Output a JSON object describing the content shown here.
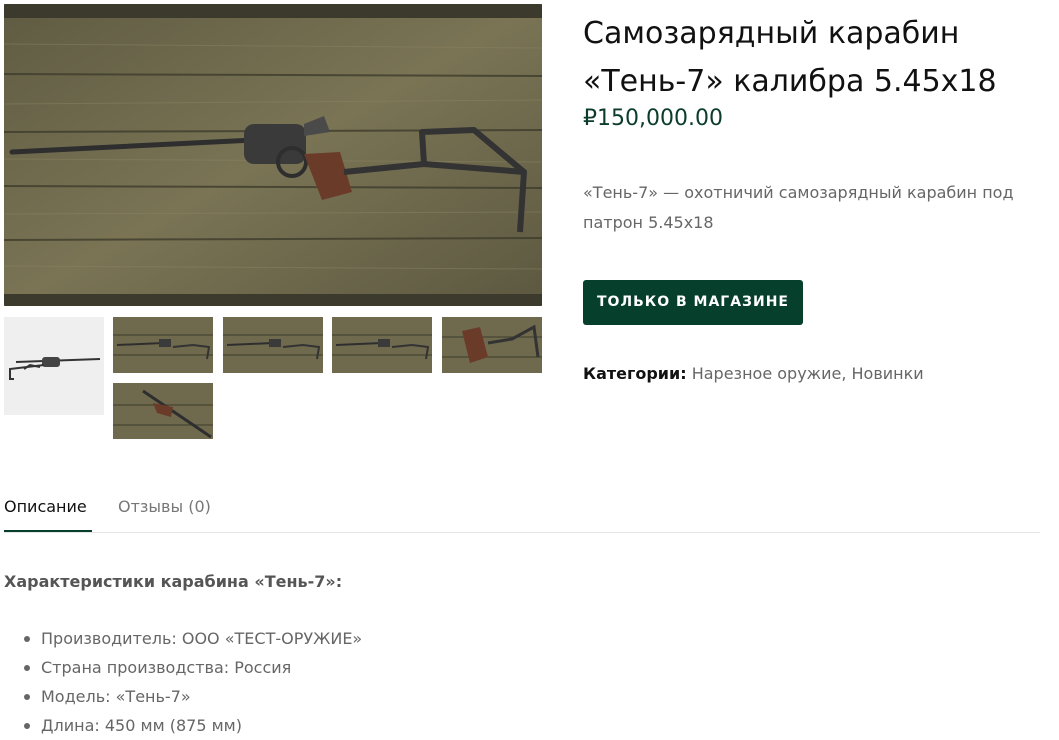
{
  "product": {
    "title_line1": "Самозарядный карабин",
    "title_line2": "«Тень-7» калибра 5.45x18",
    "price": "₽150,000.00",
    "short_description": "«Тень-7» — охотничий самозарядный карабин под патрон 5.45x18",
    "cta_label": "ТОЛЬКО В МАГАЗИНЕ",
    "categories_label": "Категории:",
    "categories": [
      "Нарезное оружие",
      "Новинки"
    ],
    "categories_separator": ","
  },
  "gallery": {
    "thumbnails": [
      "thumb-1",
      "thumb-2",
      "thumb-3",
      "thumb-4",
      "thumb-5",
      "thumb-6"
    ]
  },
  "tabs": [
    {
      "label": "Описание",
      "active": true
    },
    {
      "label": "Отзывы (0)",
      "active": false
    }
  ],
  "description": {
    "heading": "Характеристики карабина «Тень-7»:",
    "specs": [
      "Производитель: ООО «ТЕСТ-ОРУЖИЕ»",
      "Страна производства: Россия",
      "Модель: «Тень-7»",
      "Длина: 450 мм (875 мм)"
    ]
  },
  "colors": {
    "accent": "#063f2c",
    "price": "#0b3d2a",
    "wood": "#6f6a4e"
  }
}
